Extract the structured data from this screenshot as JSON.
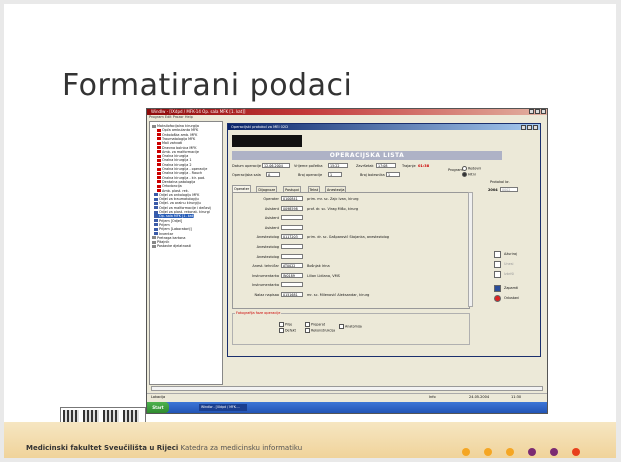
{
  "slide": {
    "title": "Formatirani podaci",
    "footer_bold": "Medicinski fakultet Sveučilišta u Rijeci",
    "footer_rest": " Katedra za medicinsku informatiku",
    "dot_colors": [
      "#f5a623",
      "#f5a623",
      "#f5a623",
      "#7b2b72",
      "#7b2b72",
      "#e8401c"
    ]
  },
  "app": {
    "window_title": "Windlw - [IXdpd / MFK-14 Op. sala MFK [1. kat]]",
    "menu": "Program  Edit  Prozor  Help",
    "tree": [
      {
        "label": "Maksilofacijalna kirurgija",
        "icon": "g"
      },
      {
        "label": "Opća ambulanta MFK",
        "icon": "r"
      },
      {
        "label": "Onkološka amb. MFK",
        "icon": "r"
      },
      {
        "label": "Traumatologija MFK",
        "icon": "r"
      },
      {
        "label": "Mali zahvati",
        "icon": "r"
      },
      {
        "label": "Dnevna bolnica MFK",
        "icon": "r"
      },
      {
        "label": "Amb. za malformacije",
        "icon": "r"
      },
      {
        "label": "Oralna kirurgija",
        "icon": "r"
      },
      {
        "label": "Oralna kirurgija 1",
        "icon": "r"
      },
      {
        "label": "Oralna kirurgija 2",
        "icon": "r"
      },
      {
        "label": "Oralna kirurgija - operacije",
        "icon": "r"
      },
      {
        "label": "Oralna kirurgija - Rauch",
        "icon": "r"
      },
      {
        "label": "Oralna kirurgija - kir. pod.",
        "icon": "r"
      },
      {
        "label": "Dentalna patologija",
        "icon": "r"
      },
      {
        "label": "Ortodoncija",
        "icon": "r"
      },
      {
        "label": "Amb. plast. rek.",
        "icon": "r"
      },
      {
        "label": "Odjel za onkologiju MFK",
        "icon": "b"
      },
      {
        "label": "Odjel za traumatologiju",
        "icon": "b"
      },
      {
        "label": "Odjel. za oralnu kirurgiju",
        "icon": "b"
      },
      {
        "label": "Odjel za malformacije i dečavij",
        "icon": "b"
      },
      {
        "label": "Odjel za plast. rekonst. kirurgi",
        "icon": "b"
      },
      {
        "label": "Op. sala MFK [1. kat]",
        "icon": "b",
        "selected": true
      },
      {
        "label": "Prijem [Odjel]",
        "icon": "b"
      },
      {
        "label": "Prijem",
        "icon": "b"
      },
      {
        "label": "Prijem [Laboratorij]",
        "icon": "b"
      },
      {
        "label": "Inventar",
        "icon": "b"
      },
      {
        "label": "Pretraga kartona",
        "icon": "g"
      },
      {
        "label": "Pitajnik",
        "icon": "g"
      },
      {
        "label": "Postavke djelatnosti",
        "icon": "g"
      }
    ],
    "status": {
      "left": "Lokacija",
      "info": "Info",
      "date": "24.05.2004",
      "time": "11:30"
    },
    "taskbar": {
      "start": "Start",
      "item": "Windlw - [IXdpd / MFK-..."
    }
  },
  "dialog": {
    "title": "Operacijski protokol za MEI 02D",
    "heading": "OPERACIJSKA LISTA",
    "datum_label": "Datum operacije",
    "datum": "12.06.2004",
    "vrijeme_label": "Vrijeme početka",
    "vrijeme": "15:22",
    "zavrsetak_label": "Završetak",
    "zavrsetak": "17:08",
    "trajanje_label": "Trajanje",
    "trajanje": "01:38",
    "sala_label": "Operacijska sala",
    "sala": "A",
    "broj_op_label": "Broj operacije",
    "broj_op": "1",
    "broj_bol_label": "Broj bolesnika",
    "broj_bol": "1",
    "program_label": "Program",
    "redovni": "Redovni",
    "hitni": "Hitni",
    "protokol_label": "Protokol br.",
    "protokol_god": "2004",
    "protokol_br": "0002",
    "tabs": [
      "Operater",
      "Dijagnoze",
      "Postupci",
      "Tekst",
      "Anestezija"
    ],
    "rows": [
      {
        "label": "Operater",
        "code": "0100841",
        "name": "prim. mr. sc. Zajc Ivan, kirurg"
      },
      {
        "label": "Asistent",
        "code": "0098598",
        "name": "prof. dr. sc. Virag Mišo, kirurg"
      },
      {
        "label": "Asistent",
        "code": "",
        "name": ""
      },
      {
        "label": "Asistent",
        "code": "",
        "name": ""
      },
      {
        "label": "Anesteziolog",
        "code": "0117203",
        "name": "prim. dr. sc. Gašparović Stojanka, anesteziolog"
      },
      {
        "label": "Anesteziolog",
        "code": "",
        "name": ""
      },
      {
        "label": "Anesteziolog",
        "code": "",
        "name": ""
      },
      {
        "label": "Anest. tehničar",
        "code": "AT0022",
        "name": "Bošnjak Irina"
      },
      {
        "label": "Instrumentarka",
        "code": "IN0189",
        "name": "Lilian Lidiana, VMS"
      },
      {
        "label": "Instrumentarka",
        "code": "",
        "name": ""
      },
      {
        "label": "Nalaz napisao",
        "code": "0151681",
        "name": "mr. sc. Milenović Aleksandar, kirurg"
      }
    ],
    "foto_label": "Fotografija faze operacije",
    "checks": [
      "Prije",
      "Defekt",
      "Preparat",
      "Rekonstrukcija",
      "Anatomija"
    ],
    "buttons": {
      "azuriraj": "Ažuriraj",
      "unesi": "Unesi",
      "izbrisi": "Izbriši",
      "zapamti": "Zapamti",
      "odustani": "Odustani"
    }
  }
}
